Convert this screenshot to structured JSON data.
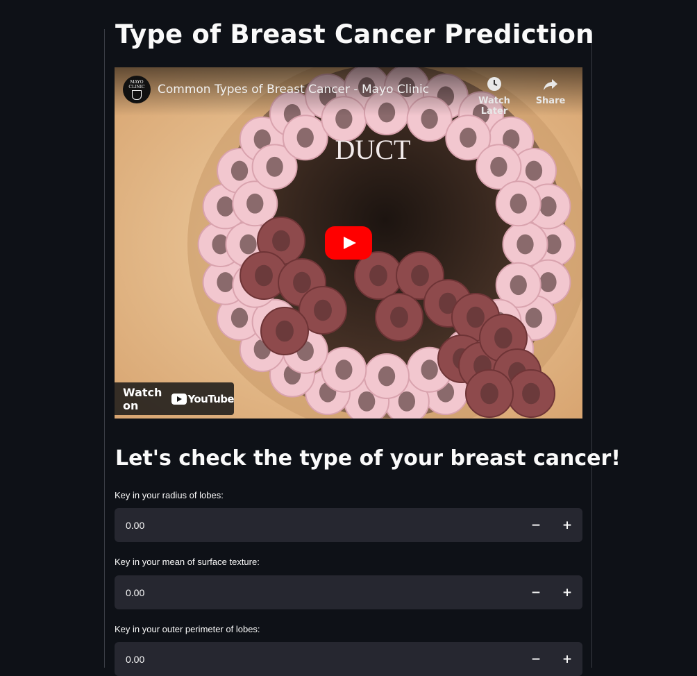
{
  "page": {
    "title": "Type of Breast Cancer Prediction",
    "subtitle": "Let's check the type of your breast cancer!"
  },
  "video": {
    "channel_logo_text": "MAYO CLINIC",
    "title": "Common Types of Breast Cancer - Mayo Clinic",
    "watch_later_label": "Watch Later",
    "share_label": "Share",
    "watch_on_label": "Watch on",
    "youtube_wordmark": "YouTube",
    "frame_caption": "DUCT",
    "icons": {
      "watch_later": "clock-icon",
      "share": "share-arrow-icon",
      "play": "play-icon",
      "youtube": "youtube-logo-icon"
    }
  },
  "form": {
    "fields": [
      {
        "label": "Key in your radius of lobes:",
        "value": "0.00",
        "minus": "−",
        "plus": "+"
      },
      {
        "label": "Key in your mean of surface texture:",
        "value": "0.00",
        "minus": "−",
        "plus": "+"
      },
      {
        "label": "Key in your outer perimeter of lobes:",
        "value": "0.00",
        "minus": "−",
        "plus": "+"
      }
    ]
  },
  "colors": {
    "background": "#0e1117",
    "input_background": "#262730",
    "text": "#fafafa",
    "play_button": "#ff0000"
  }
}
